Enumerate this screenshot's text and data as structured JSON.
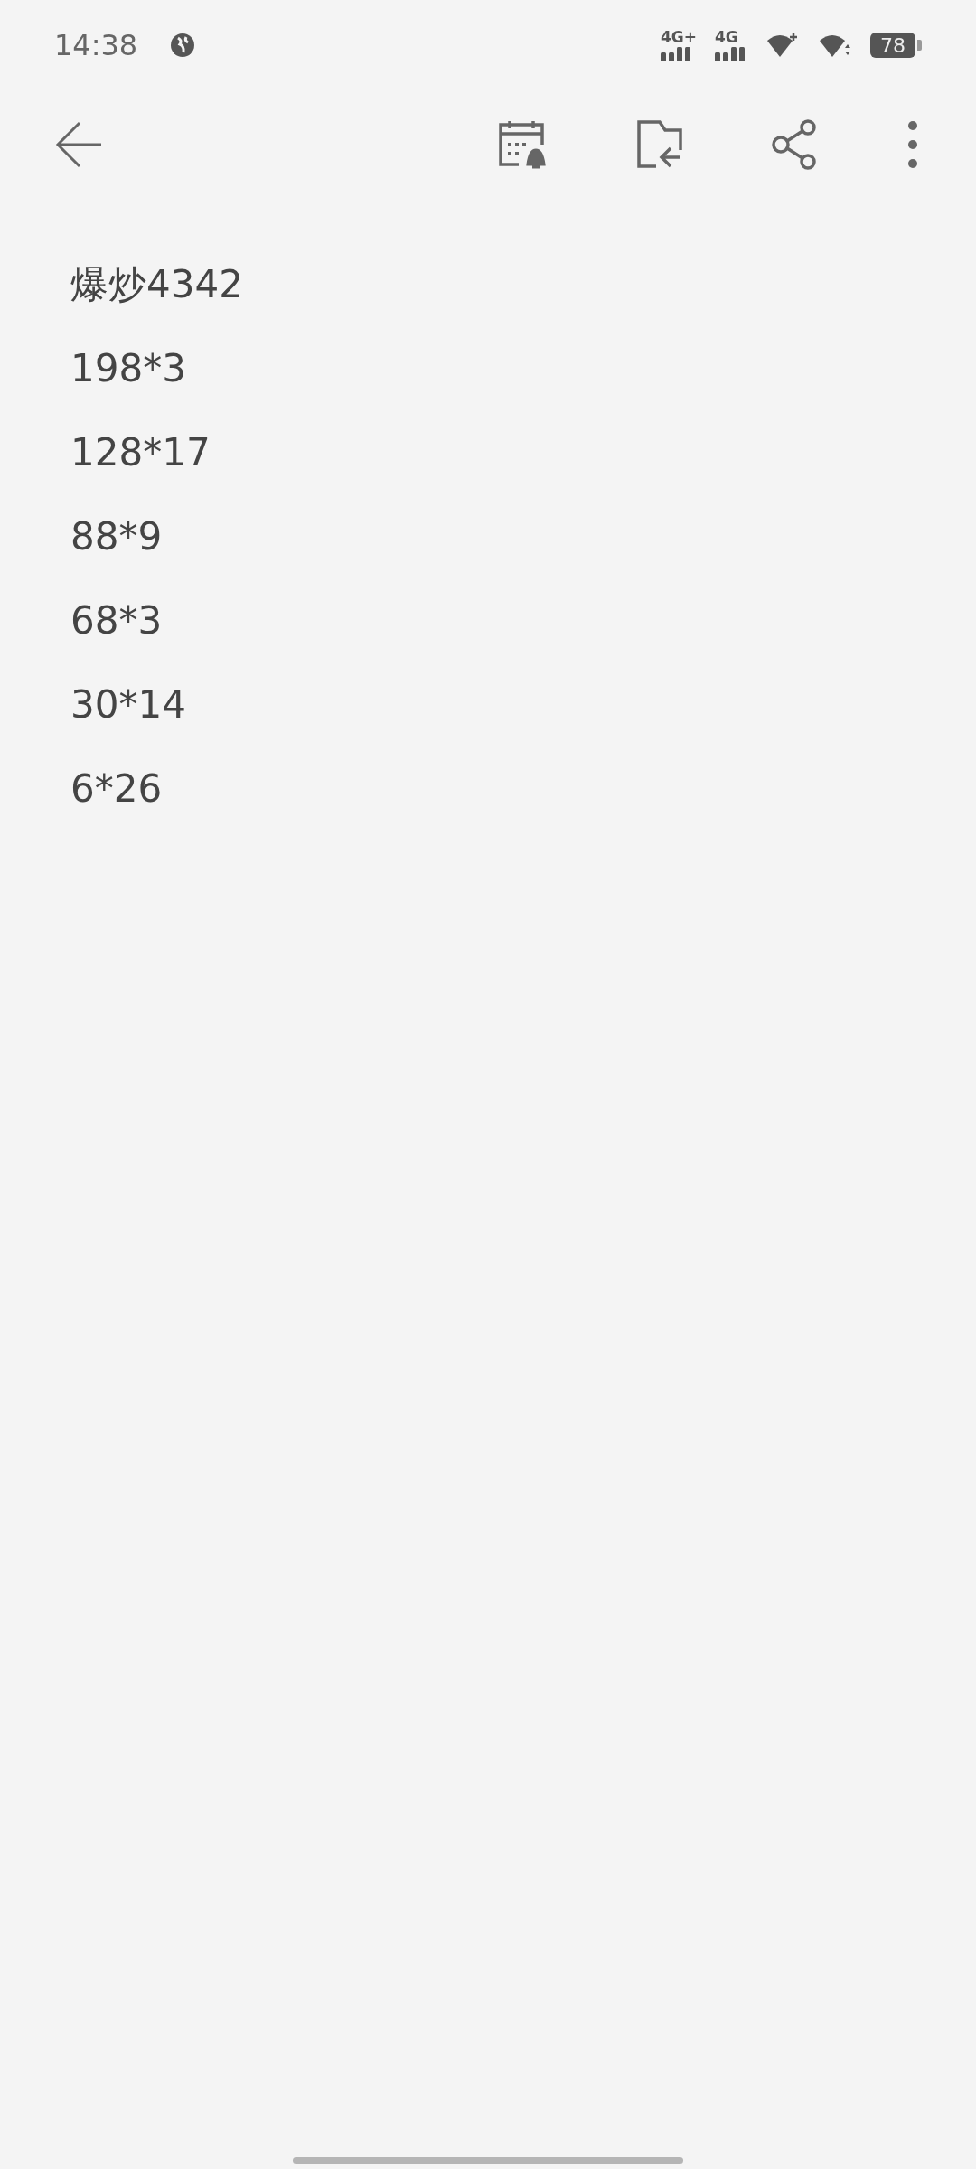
{
  "status_bar": {
    "time": "14:38",
    "network_1": "4G+",
    "network_2": "4G",
    "battery": "78"
  },
  "note": {
    "lines": [
      "爆炒4342",
      "198*3",
      "128*17",
      "88*9",
      "68*3",
      "30*14",
      "6*26"
    ]
  }
}
